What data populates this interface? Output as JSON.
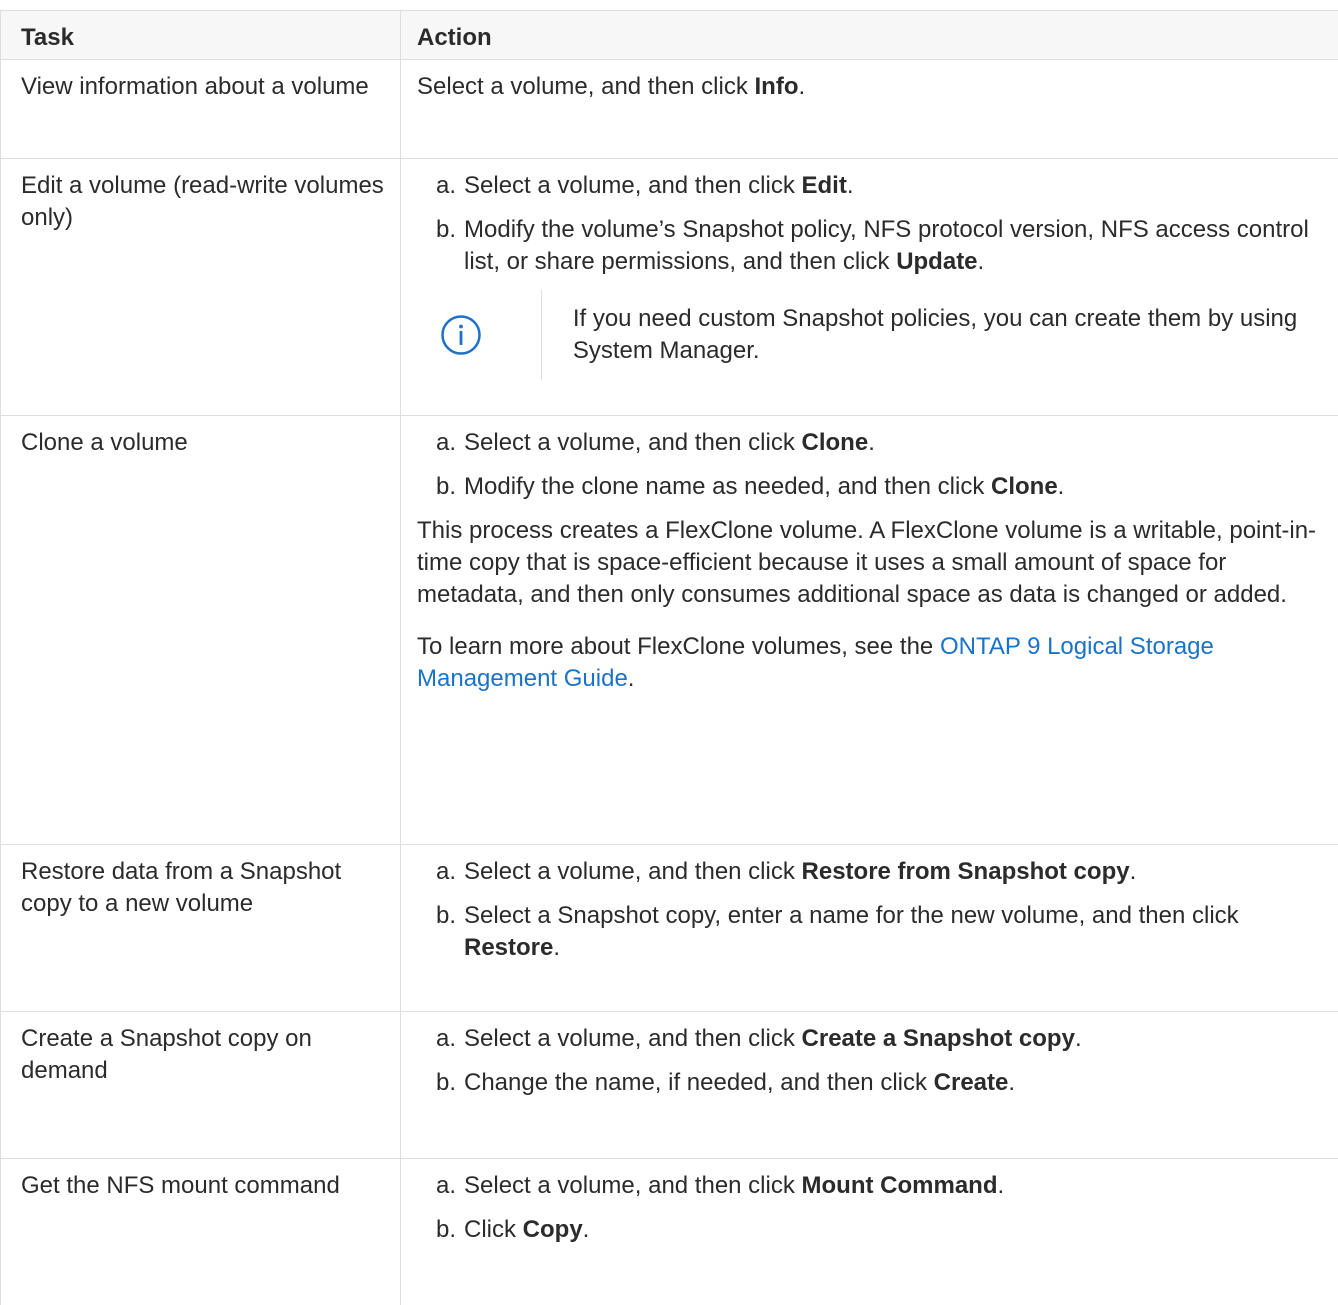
{
  "table": {
    "headers": [
      "Task",
      "Action"
    ],
    "rows": {
      "view": {
        "task": "View information about a volume",
        "action": {
          "prefix": "Select a volume, and then click ",
          "bold": "Info",
          "suffix": "."
        }
      },
      "edit": {
        "task": "Edit a volume (read-write volumes only)",
        "steps": [
          {
            "marker": "a.",
            "prefix": "Select a volume, and then click ",
            "bold": "Edit",
            "suffix": "."
          },
          {
            "marker": "b.",
            "prefix": "Modify the volume’s Snapshot policy, NFS protocol version, NFS access control list, or share permissions, and then click ",
            "bold": "Update",
            "suffix": "."
          }
        ],
        "note": {
          "icon": "info-circle-icon",
          "text": "If you need custom Snapshot policies, you can create them by using System Manager."
        }
      },
      "clone": {
        "task": "Clone a volume",
        "steps": [
          {
            "marker": "a.",
            "prefix": "Select a volume, and then click ",
            "bold": "Clone",
            "suffix": "."
          },
          {
            "marker": "b.",
            "prefix": "Modify the clone name as needed, and then click ",
            "bold": "Clone",
            "suffix": "."
          }
        ],
        "paragraph": "This process creates a FlexClone volume. A FlexClone volume is a writable, point-in-time copy that is space-efficient because it uses a small amount of space for metadata, and then only consumes additional space as data is changed or added.",
        "learn_more": {
          "prefix": "To learn more about FlexClone volumes, see the ",
          "link": "ONTAP 9 Logical Storage Management Guide",
          "suffix": "."
        }
      },
      "restore": {
        "task": "Restore data from a Snapshot copy to a new volume",
        "steps": [
          {
            "marker": "a.",
            "prefix": "Select a volume, and then click ",
            "bold": "Restore from Snapshot copy",
            "suffix": "."
          },
          {
            "marker": "b.",
            "prefix": "Select a Snapshot copy, enter a name for the new volume, and then click ",
            "bold": "Restore",
            "suffix": "."
          }
        ]
      },
      "snapshot": {
        "task": "Create a Snapshot copy on demand",
        "steps": [
          {
            "marker": "a.",
            "prefix": "Select a volume, and then click ",
            "bold": "Create a Snapshot copy",
            "suffix": "."
          },
          {
            "marker": "b.",
            "prefix": "Change the name, if needed, and then click ",
            "bold": "Create",
            "suffix": "."
          }
        ]
      },
      "mount": {
        "task": "Get the NFS mount command",
        "steps": [
          {
            "marker": "a.",
            "prefix": "Select a volume, and then click ",
            "bold": "Mount Command",
            "suffix": "."
          },
          {
            "marker": "b.",
            "prefix": "Click ",
            "bold": "Copy",
            "suffix": "."
          }
        ]
      }
    }
  },
  "colors": {
    "link": "#1a73c9",
    "info_icon": "#1a73c9",
    "header_bg": "#f7f7f7",
    "border": "#dedede",
    "text": "#2b2b2b"
  }
}
